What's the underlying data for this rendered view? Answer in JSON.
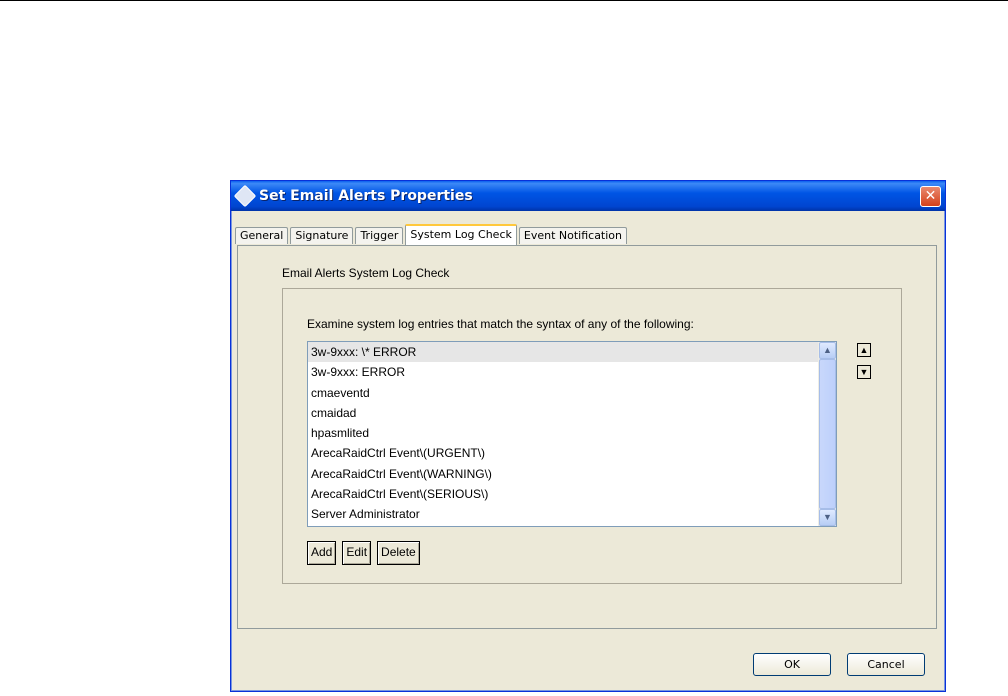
{
  "dialog": {
    "title": "Set Email Alerts Properties",
    "close_symbol": "✕"
  },
  "tabs": [
    {
      "label": "General"
    },
    {
      "label": "Signature"
    },
    {
      "label": "Trigger"
    },
    {
      "label": "System Log Check",
      "active": true
    },
    {
      "label": "Event Notification"
    }
  ],
  "panel": {
    "heading": "Email Alerts System Log Check",
    "instruction": "Examine system log entries that match the syntax of any of the following:"
  },
  "log_patterns": [
    "3w-9xxx: \\* ERROR",
    "3w-9xxx: ERROR",
    "cmaeventd",
    "cmaidad",
    "hpasmlited",
    "ArecaRaidCtrl Event\\(URGENT\\)",
    "ArecaRaidCtrl Event\\(WARNING\\)",
    "ArecaRaidCtrl Event\\(SERIOUS\\)",
    "Server Administrator"
  ],
  "selected_index": 0,
  "scroll": {
    "up_symbol": "▲",
    "down_symbol": "▼"
  },
  "move": {
    "up_symbol": "▲",
    "down_symbol": "▼"
  },
  "buttons": {
    "add": "Add",
    "edit": "Edit",
    "delete": "Delete",
    "ok": "OK",
    "cancel": "Cancel"
  },
  "colors": {
    "title_bar": "#0055e5",
    "close_button": "#d5401a",
    "active_tab_accent": "#ffc83c",
    "selected_row": "#e6e6e6"
  },
  "icons": {
    "title_icon": "app-diamond-icon",
    "close": "close-icon",
    "scroll_up": "scroll-up-arrow-icon",
    "scroll_down": "scroll-down-arrow-icon",
    "move_up": "move-up-arrow-icon",
    "move_down": "move-down-arrow-icon"
  }
}
